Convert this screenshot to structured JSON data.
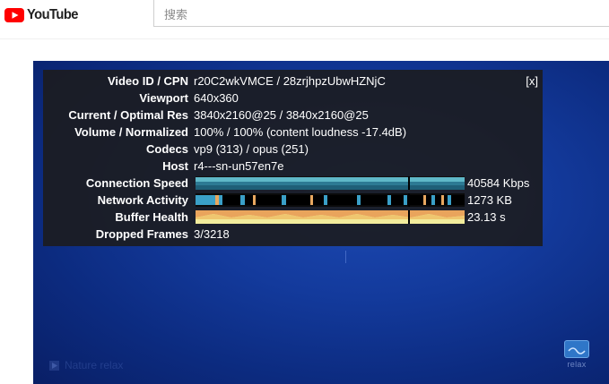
{
  "header": {
    "logo_text": "YouTube",
    "search_placeholder": "搜索",
    "brand_color": "#ff0000"
  },
  "video": {
    "caption": "Nature relax",
    "overlay_logo_text": "relax"
  },
  "stats": {
    "close_label": "[x]",
    "rows": [
      {
        "label": "Video ID / CPN",
        "value": "r20C2wkVMCE / 28zrjhpzUbwHZNjC"
      },
      {
        "label": "Viewport",
        "value": "640x360"
      },
      {
        "label": "Current / Optimal Res",
        "value": "3840x2160@25 / 3840x2160@25"
      },
      {
        "label": "Volume / Normalized",
        "value": "100% / 100% (content loudness -17.4dB)"
      },
      {
        "label": "Codecs",
        "value": "vp9 (313) / opus (251)"
      },
      {
        "label": "Host",
        "value": "r4---sn-un57en7e"
      },
      {
        "label": "Connection Speed",
        "value": "40584 Kbps"
      },
      {
        "label": "Network Activity",
        "value": "1273 KB"
      },
      {
        "label": "Buffer Health",
        "value": "23.13 s"
      },
      {
        "label": "Dropped Frames",
        "value": "3/3218"
      }
    ]
  }
}
